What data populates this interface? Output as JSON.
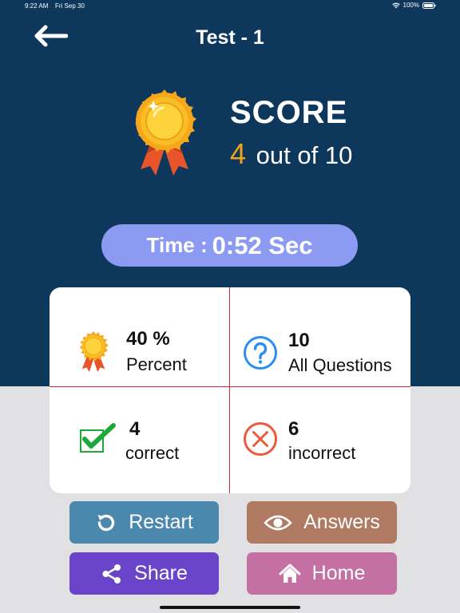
{
  "status_bar": {
    "time": "9:22 AM",
    "date": "Fri Sep 30",
    "battery": "100%"
  },
  "header": {
    "title": "Test - 1"
  },
  "score": {
    "label": "SCORE",
    "correct": "4",
    "suffix": "out of 10"
  },
  "time": {
    "label": "Time :",
    "value": "0:52 Sec"
  },
  "stats": {
    "percent": {
      "value": "40 %",
      "label": "Percent"
    },
    "questions": {
      "value": "10",
      "label": "All Questions"
    },
    "correct": {
      "value": "4",
      "label": "correct"
    },
    "incorrect": {
      "value": "6",
      "label": "incorrect"
    }
  },
  "buttons": {
    "restart": "Restart",
    "answers": "Answers",
    "share": "Share",
    "home": "Home"
  },
  "colors": {
    "header_bg": "#0e375c",
    "accent_orange": "#f1a51b",
    "time_pill": "#8c9af2",
    "divider": "#d4263c",
    "restart": "#4a88ad",
    "answers": "#b07a62",
    "share": "#6b45c9",
    "home": "#c470a2"
  },
  "icons": {
    "back": "arrow-left-icon",
    "medal": "medal-icon",
    "question": "question-circle-icon",
    "check": "checkmark-icon",
    "cross": "x-circle-icon",
    "restart": "refresh-icon",
    "answers": "eye-icon",
    "share": "share-icon",
    "home": "home-icon"
  }
}
